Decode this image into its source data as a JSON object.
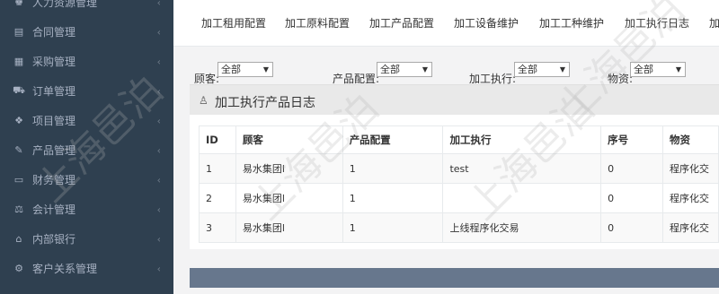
{
  "sidebar": {
    "items": [
      {
        "label": "人力资源管理",
        "icon": "users-icon",
        "glyph": "♚"
      },
      {
        "label": "合同管理",
        "icon": "document-icon",
        "glyph": "▤"
      },
      {
        "label": "采购管理",
        "icon": "list-icon",
        "glyph": "▦"
      },
      {
        "label": "订单管理",
        "icon": "cart-icon",
        "glyph": "⛟"
      },
      {
        "label": "项目管理",
        "icon": "cubes-icon",
        "glyph": "❖"
      },
      {
        "label": "产品管理",
        "icon": "edit-icon",
        "glyph": "✎"
      },
      {
        "label": "财务管理",
        "icon": "money-icon",
        "glyph": "▭"
      },
      {
        "label": "会计管理",
        "icon": "balance-icon",
        "glyph": "⚖"
      },
      {
        "label": "内部银行",
        "icon": "bank-icon",
        "glyph": "⌂"
      },
      {
        "label": "客户关系管理",
        "icon": "cogs-icon",
        "glyph": "⚙"
      }
    ]
  },
  "tabs": [
    "加工租用配置",
    "加工原料配置",
    "加工产品配置",
    "加工设备维护",
    "加工工种维护",
    "加工执行日志",
    "加"
  ],
  "filters": {
    "customer_label": "顾客:",
    "customer_value": "全部",
    "product_label": "产品配置:",
    "product_value": "全部",
    "exec_label": "加工执行:",
    "exec_value": "全部",
    "material_label": "物资:",
    "material_value": "全部"
  },
  "panel": {
    "title": "加工执行产品日志"
  },
  "table": {
    "headers": [
      "ID",
      "顾客",
      "产品配置",
      "加工执行",
      "序号",
      "物资"
    ],
    "rows": [
      [
        "1",
        "易水集团l",
        "1",
        "test",
        "0",
        "程序化交"
      ],
      [
        "2",
        "易水集团l",
        "1",
        "",
        "0",
        "程序化交"
      ],
      [
        "3",
        "易水集团l",
        "1",
        "上线程序化交易",
        "0",
        "程序化交"
      ]
    ]
  },
  "watermark": "上海邑泊",
  "colors": {
    "sidebar_bg": "#2f4050",
    "sidebar_text": "#a7b1c2",
    "footer_bar": "#67778d"
  }
}
